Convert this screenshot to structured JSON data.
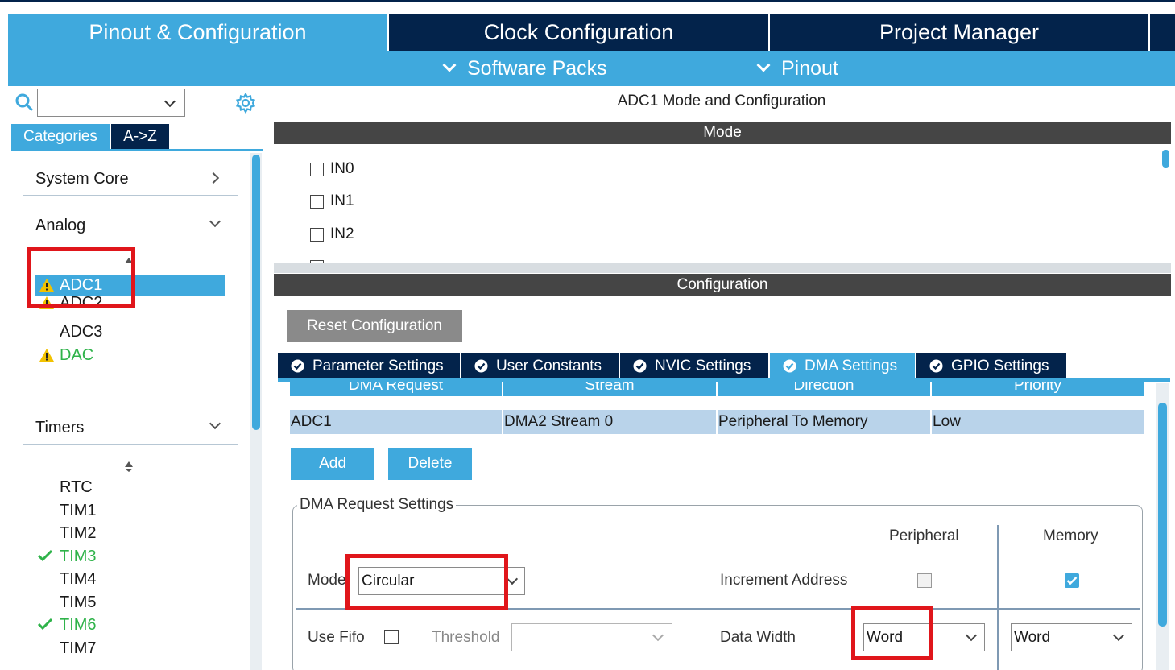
{
  "main_tabs": [
    {
      "label": "Pinout & Configuration",
      "active": true
    },
    {
      "label": "Clock Configuration",
      "active": false
    },
    {
      "label": "Project Manager",
      "active": false
    }
  ],
  "sub_menu": [
    {
      "label": "Software Packs"
    },
    {
      "label": "Pinout"
    }
  ],
  "sidebar": {
    "search_value": "",
    "category_tabs": [
      {
        "label": "Categories",
        "active": true
      },
      {
        "label": "A->Z",
        "active": false
      }
    ],
    "categories": [
      {
        "label": "System Core",
        "expanded": false
      },
      {
        "label": "Analog",
        "expanded": true
      },
      {
        "label": "Timers",
        "expanded": true
      }
    ],
    "analog_items": [
      {
        "label": "ADC1",
        "status": "warning",
        "selected": true
      },
      {
        "label": "ADC2",
        "status": "warning",
        "selected": false
      },
      {
        "label": "ADC3",
        "status": "none",
        "selected": false
      },
      {
        "label": "DAC",
        "status": "warning",
        "selected": false
      }
    ],
    "timer_items": [
      {
        "label": "RTC",
        "status": "none"
      },
      {
        "label": "TIM1",
        "status": "none"
      },
      {
        "label": "TIM2",
        "status": "none"
      },
      {
        "label": "TIM3",
        "status": "ok"
      },
      {
        "label": "TIM4",
        "status": "none"
      },
      {
        "label": "TIM5",
        "status": "none"
      },
      {
        "label": "TIM6",
        "status": "ok"
      },
      {
        "label": "TIM7",
        "status": "none"
      }
    ]
  },
  "panel": {
    "title": "ADC1 Mode and Configuration",
    "mode_header": "Mode",
    "mode_items": [
      {
        "label": "IN0",
        "checked": false
      },
      {
        "label": "IN1",
        "checked": false
      },
      {
        "label": "IN2",
        "checked": false
      }
    ],
    "config_header": "Configuration",
    "reset_label": "Reset Configuration",
    "config_tabs": [
      {
        "label": "Parameter Settings",
        "active": false
      },
      {
        "label": "User Constants",
        "active": false
      },
      {
        "label": "NVIC Settings",
        "active": false
      },
      {
        "label": "DMA Settings",
        "active": true
      },
      {
        "label": "GPIO Settings",
        "active": false
      }
    ]
  },
  "dma": {
    "columns": [
      "DMA Request",
      "Stream",
      "Direction",
      "Priority"
    ],
    "rows": [
      {
        "request": "ADC1",
        "stream": "DMA2 Stream 0",
        "direction": "Peripheral To Memory",
        "priority": "Low"
      }
    ],
    "add_label": "Add",
    "delete_label": "Delete",
    "settings": {
      "legend": "DMA Request Settings",
      "peripheral_label": "Peripheral",
      "memory_label": "Memory",
      "mode_label": "Mode",
      "mode_value": "Circular",
      "increment_label": "Increment Address",
      "increment_peripheral": false,
      "increment_memory": true,
      "use_fifo_label": "Use Fifo",
      "use_fifo": false,
      "threshold_label": "Threshold",
      "threshold_value": "",
      "data_width_label": "Data Width",
      "peripheral_width": "Word",
      "memory_width": "Word"
    }
  },
  "colors": {
    "navy": "#03234b",
    "accent_blue": "#3fa9dd",
    "highlight_red": "#e0161b",
    "ok_green": "#2fb34a",
    "warning_yellow": "#f2c200"
  }
}
